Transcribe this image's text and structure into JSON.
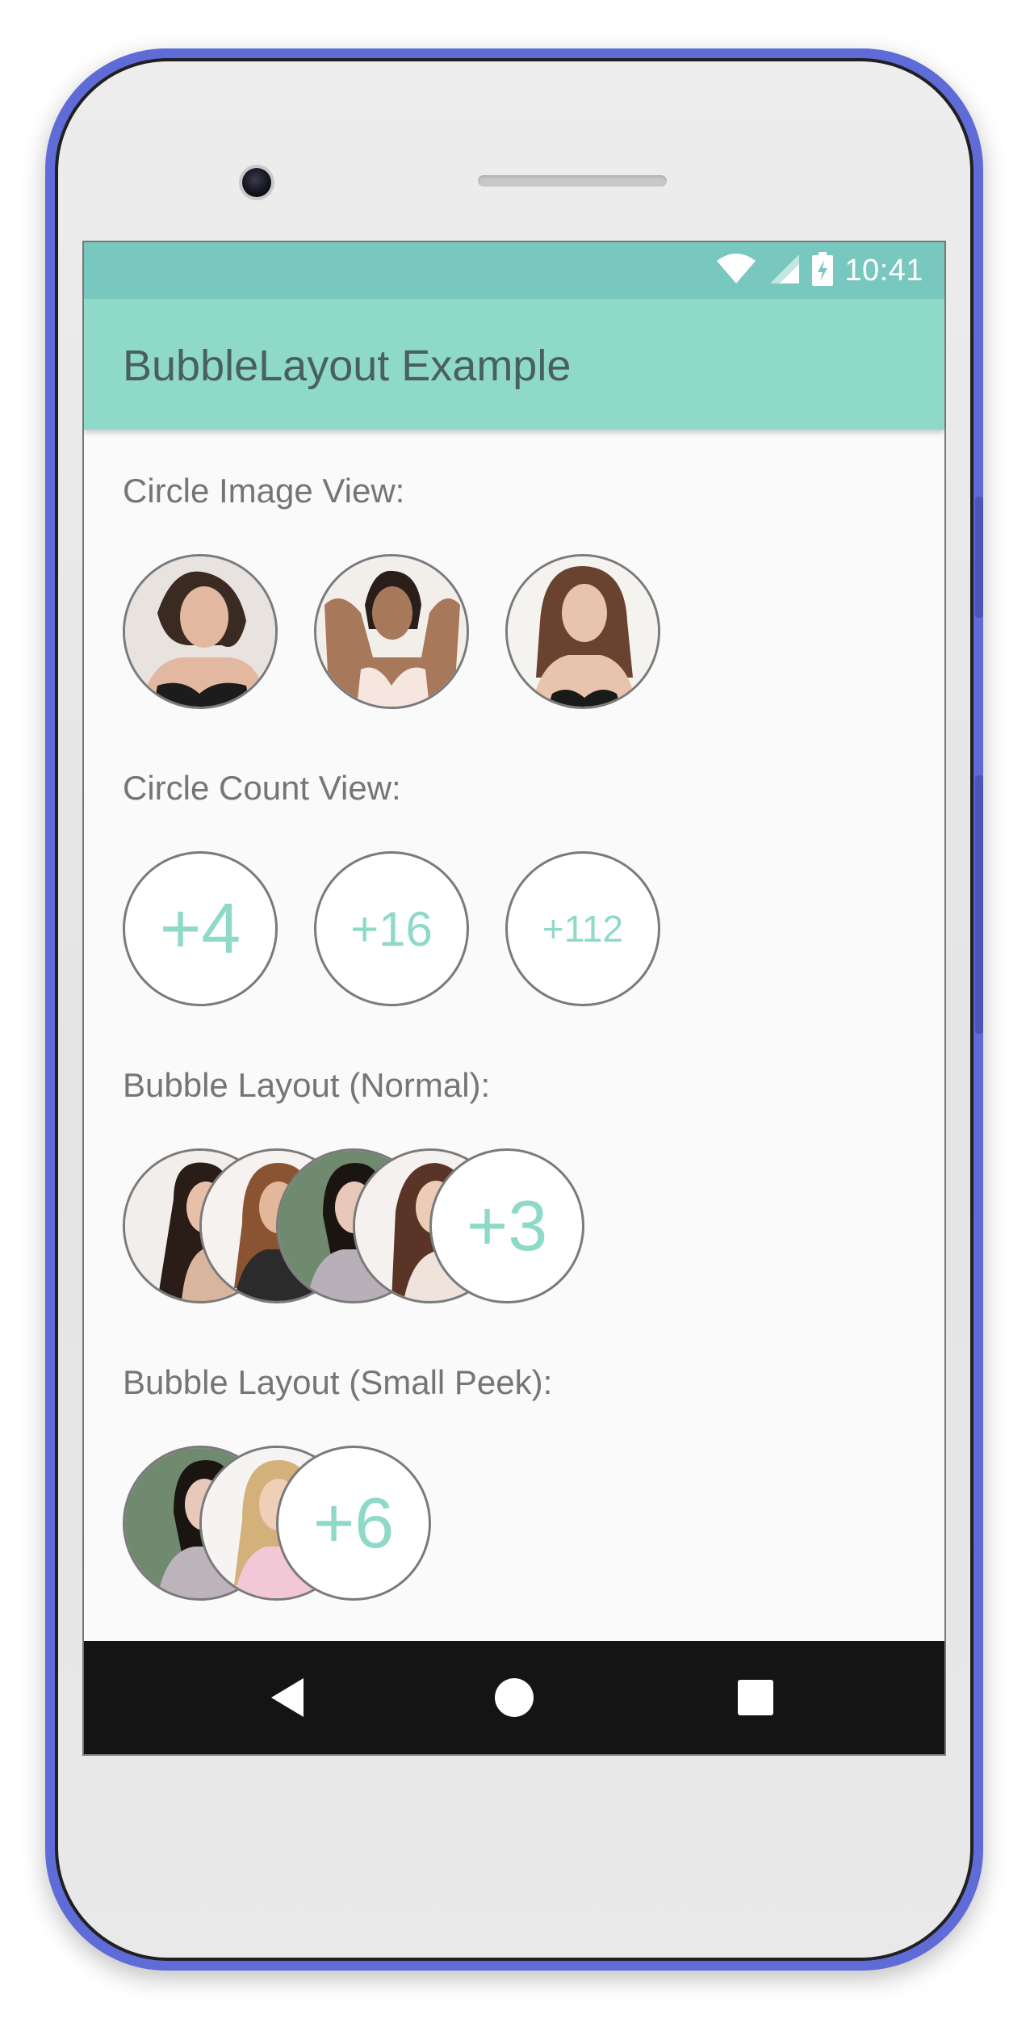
{
  "colors": {
    "status_bar": "#78c8bf",
    "app_bar": "#8fd9c8",
    "accent_text": "#8fd9c8",
    "nav_bar": "#141414",
    "phone_frame": "#5f6bd6"
  },
  "status_bar": {
    "time": "10:41",
    "icons": [
      "wifi-icon",
      "cellular-signal-icon",
      "battery-charging-icon"
    ]
  },
  "app_bar": {
    "title": "BubbleLayout Example"
  },
  "sections": {
    "circle_image": {
      "label": "Circle Image View:",
      "items": [
        "portrait-photo",
        "portrait-photo",
        "portrait-photo"
      ]
    },
    "circle_count": {
      "label": "Circle Count View:",
      "counts": [
        "+4",
        "+16",
        "+112"
      ]
    },
    "bubble_normal": {
      "label": "Bubble Layout (Normal):",
      "photos": [
        "portrait-photo",
        "portrait-photo",
        "portrait-photo",
        "portrait-photo"
      ],
      "count": "+3"
    },
    "bubble_small_peek": {
      "label": "Bubble Layout (Small Peek):",
      "photos": [
        "portrait-photo",
        "portrait-photo"
      ],
      "count": "+6"
    }
  },
  "nav_bar": {
    "buttons": [
      "back-icon",
      "home-icon",
      "recents-icon"
    ]
  }
}
